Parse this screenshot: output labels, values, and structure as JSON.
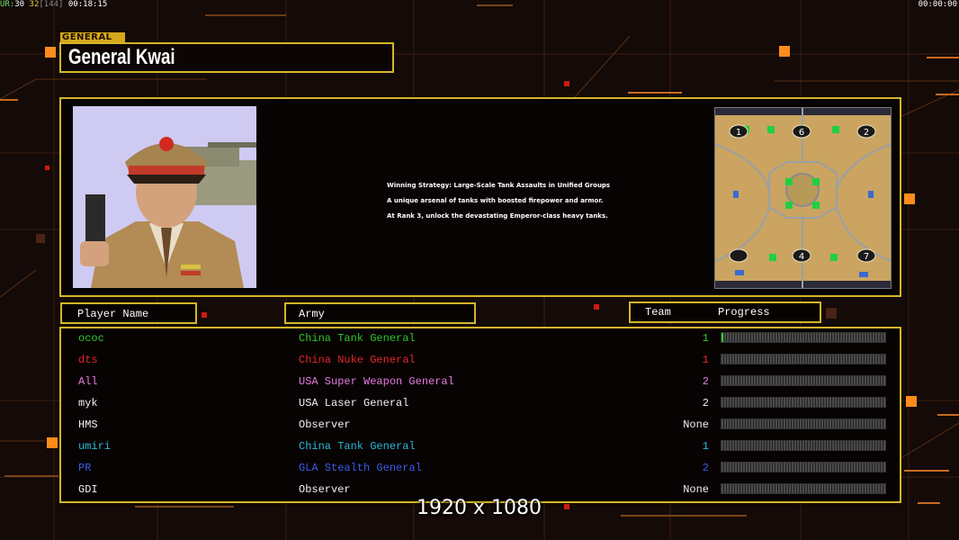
{
  "hud": {
    "fps_prefix": "UR:",
    "fps_a": "30",
    "fps_b": "32",
    "fps_c": "[144]",
    "elapsed": "00:18:15",
    "game_clock": "00:00:00"
  },
  "general": {
    "category": "GENERAL",
    "name": "General Kwai",
    "portrait_icon": "general-portrait",
    "strategy_lines": [
      "Winning Strategy: Large-Scale Tank Assaults in Unified Groups",
      "A unique arsenal of tanks with boosted firepower and armor.",
      "At Rank 3, unlock the devastating Emperor-class heavy tanks."
    ]
  },
  "minimap": {
    "icon": "map-preview",
    "start_positions": [
      "1",
      "6",
      "2",
      "4",
      "7"
    ]
  },
  "table": {
    "headers": {
      "player_name": "Player Name",
      "army": "Army",
      "team": "Team",
      "progress": "Progress"
    },
    "rows": [
      {
        "name": "ococ",
        "army": "China Tank General",
        "team": "1",
        "color": "#2ec72e",
        "progress": 0.01
      },
      {
        "name": "dts",
        "army": "China Nuke General",
        "team": "1",
        "color": "#e5262a",
        "progress": 0
      },
      {
        "name": "All",
        "army": "USA Super Weapon General",
        "team": "2",
        "color": "#e57adf",
        "progress": 0
      },
      {
        "name": "myk",
        "army": "USA Laser General",
        "team": "2",
        "color": "#f2f2f2",
        "progress": 0
      },
      {
        "name": "HMS",
        "army": "Observer",
        "team": "None",
        "color": "#f2f2f2",
        "progress": 0
      },
      {
        "name": "umiri",
        "army": "China Tank General",
        "team": "1",
        "color": "#2ab8d8",
        "progress": 0
      },
      {
        "name": "PR",
        "army": "GLA Stealth General",
        "team": "2",
        "color": "#3a5be8",
        "progress": 0
      },
      {
        "name": "GDI",
        "army": "Observer",
        "team": "None",
        "color": "#f2f2f2",
        "progress": 0
      }
    ]
  },
  "resolution": "1920 x 1080",
  "colors": {
    "frame": "#d4b52a",
    "accent_orange": "#ff8c1a",
    "background": "#140a07"
  }
}
